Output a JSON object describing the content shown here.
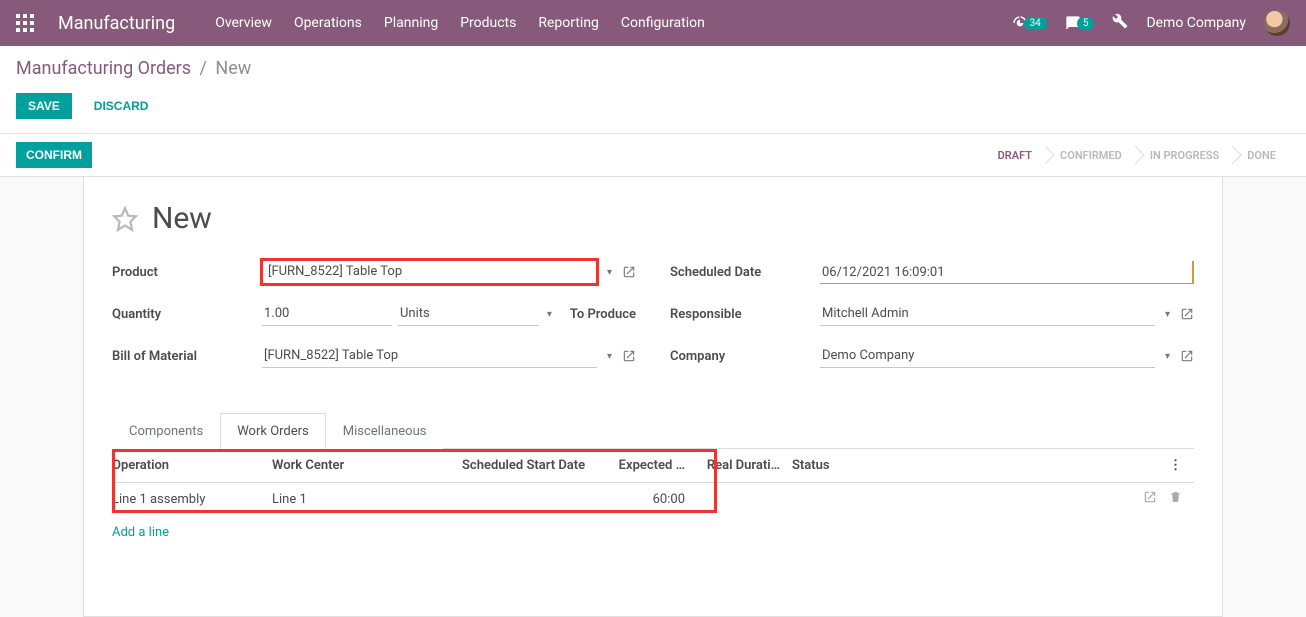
{
  "brand": "Manufacturing",
  "nav": {
    "overview": "Overview",
    "operations": "Operations",
    "planning": "Planning",
    "products": "Products",
    "reporting": "Reporting",
    "configuration": "Configuration"
  },
  "topright": {
    "clock_badge": "34",
    "chat_badge": "5",
    "company": "Demo Company"
  },
  "breadcrumb": {
    "root": "Manufacturing Orders",
    "current": "New"
  },
  "buttons": {
    "save": "SAVE",
    "discard": "DISCARD",
    "confirm": "CONFIRM"
  },
  "status": {
    "draft": "DRAFT",
    "confirmed": "CONFIRMED",
    "inprogress": "IN PROGRESS",
    "done": "DONE"
  },
  "title": "New",
  "fields": {
    "product_label": "Product",
    "product_value": "[FURN_8522] Table Top",
    "quantity_label": "Quantity",
    "quantity_value": "1.00",
    "quantity_uom": "Units",
    "to_produce": "To Produce",
    "bom_label": "Bill of Material",
    "bom_value": "[FURN_8522] Table Top",
    "scheduled_label": "Scheduled Date",
    "scheduled_value": "06/12/2021 16:09:01",
    "responsible_label": "Responsible",
    "responsible_value": "Mitchell Admin",
    "company_label": "Company",
    "company_value": "Demo Company"
  },
  "tabs": {
    "components": "Components",
    "workorders": "Work Orders",
    "misc": "Miscellaneous"
  },
  "wo_headers": {
    "operation": "Operation",
    "workcenter": "Work Center",
    "scheduled": "Scheduled Start Date",
    "expected": "Expected …",
    "real": "Real Durati…",
    "status": "Status"
  },
  "wo_rows": [
    {
      "operation": "Line 1 assembly",
      "workcenter": "Line 1",
      "scheduled": "",
      "expected": "60:00",
      "real": "",
      "status": ""
    }
  ],
  "add_line": "Add a line"
}
